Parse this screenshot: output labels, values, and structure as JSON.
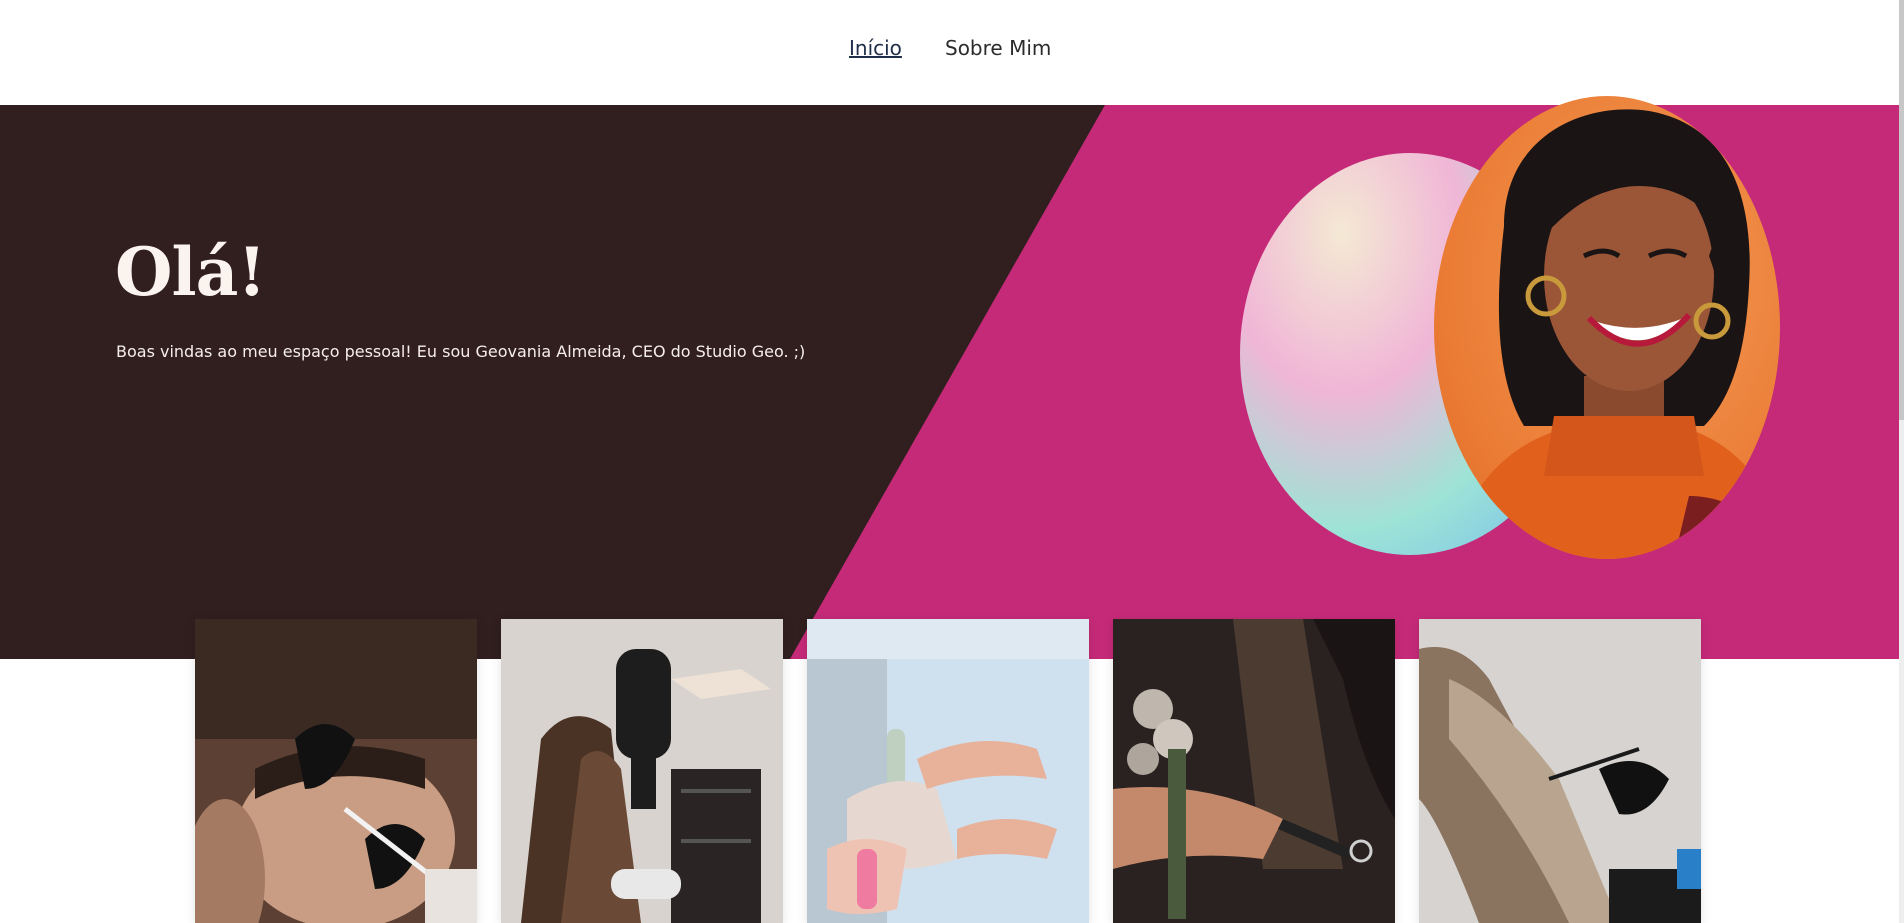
{
  "nav": {
    "items": [
      {
        "label": "Início",
        "active": true
      },
      {
        "label": "Sobre Mim",
        "active": false
      }
    ]
  },
  "hero": {
    "title": "Olá!",
    "subtitle": "Boas vindas ao meu espaço pessoal! Eu sou Geovania Almeida, CEO do Studio Geo. ;)",
    "colors": {
      "dark": "#311f1f",
      "accent": "#c52a78",
      "text": "#fbf3ee"
    },
    "portrait_icon": "woman-portrait-icon"
  },
  "gallery": {
    "items": [
      {
        "icon": "eyebrow-treatment-photo"
      },
      {
        "icon": "hair-dryer-photo"
      },
      {
        "icon": "manicure-photo"
      },
      {
        "icon": "haircut-photo"
      },
      {
        "icon": "hair-coloring-photo"
      }
    ]
  }
}
